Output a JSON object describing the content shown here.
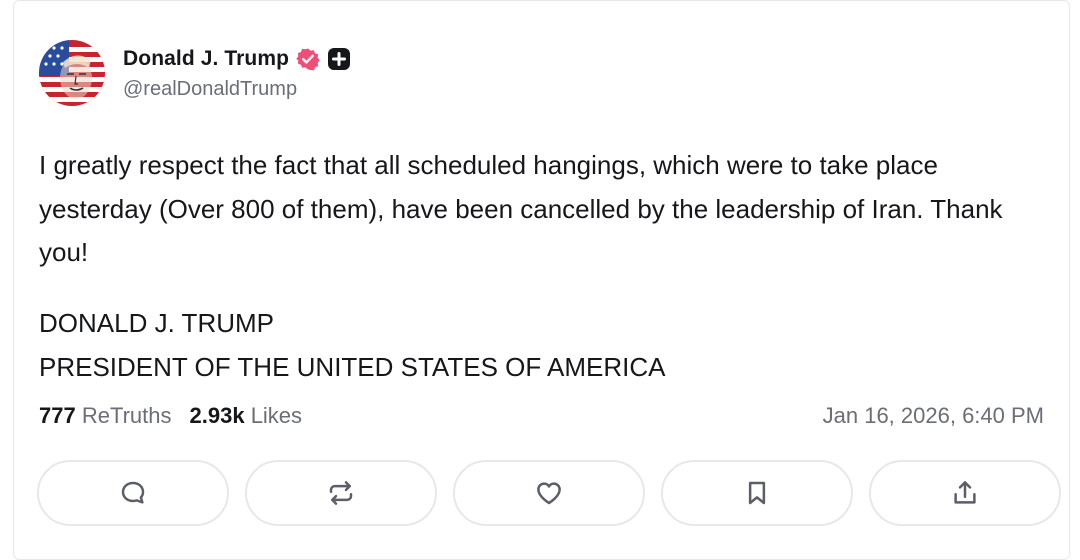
{
  "post": {
    "author": {
      "display_name": "Donald J. Trump",
      "handle": "@realDonaldTrump",
      "avatar_icon": "avatar-flag-portrait",
      "verified_icon": "verified-badge-icon",
      "plus_icon": "plus-badge-icon",
      "verified_color": "#ef4e77"
    },
    "body": "I greatly respect the fact that all scheduled hangings, which were to take place yesterday (Over 800 of them), have been cancelled by the leadership of Iran. Thank you!",
    "signature": {
      "line1": "DONALD J. TRUMP",
      "line2": "PRESIDENT OF THE UNITED STATES OF AMERICA"
    },
    "stats": {
      "retruths_count": "777",
      "retruths_label": "ReTruths",
      "likes_count": "2.93k",
      "likes_label": "Likes"
    },
    "timestamp": "Jan 16, 2026, 6:40 PM",
    "actions": [
      {
        "name": "reply",
        "icon": "comment-icon"
      },
      {
        "name": "retruth",
        "icon": "repost-icon"
      },
      {
        "name": "like",
        "icon": "heart-icon"
      },
      {
        "name": "bookmark",
        "icon": "bookmark-icon"
      },
      {
        "name": "share",
        "icon": "share-icon"
      }
    ]
  },
  "colors": {
    "text_primary": "#16171b",
    "text_secondary": "#6b6d77",
    "border": "#e8e8ec",
    "icon": "#5c5e69"
  }
}
